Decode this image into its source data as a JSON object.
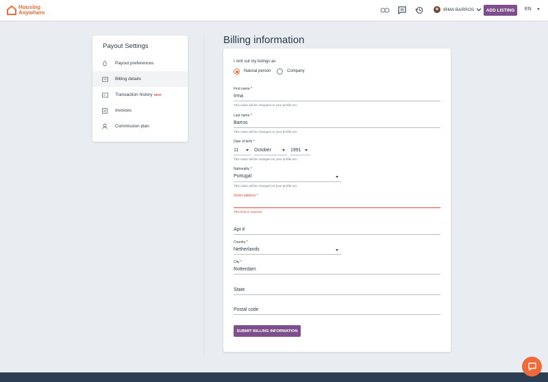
{
  "brand": {
    "line1": "Housing",
    "line2": "Anywhere",
    "color": "#ef6a3a"
  },
  "header": {
    "icons": [
      "favorites-icon",
      "messages-icon",
      "history-icon"
    ],
    "user_name": "IRMA BARROS",
    "add_listing_label": "ADD LISTING",
    "language": "EN"
  },
  "sidebar": {
    "title": "Payout Settings",
    "items": [
      {
        "label": "Payout preferences",
        "icon": "payout-icon",
        "badge": ""
      },
      {
        "label": "Billing details",
        "icon": "billing-icon",
        "badge": "",
        "active": true
      },
      {
        "label": "Transaction history",
        "icon": "transaction-icon",
        "badge": "NEW"
      },
      {
        "label": "Invoices",
        "icon": "invoice-icon",
        "badge": ""
      },
      {
        "label": "Commission plan",
        "icon": "commission-icon",
        "badge": ""
      }
    ]
  },
  "main": {
    "title": "Billing information",
    "rent_label": "I rent out my listings as",
    "rent_options": [
      {
        "label": "Natural person",
        "selected": true
      },
      {
        "label": "Company",
        "selected": false
      }
    ],
    "first_name": {
      "label": "First name *",
      "value": "Irma",
      "hint": "This value will be changed on your profile too."
    },
    "last_name": {
      "label": "Last name *",
      "value": "Barros",
      "hint": "This value will be changed on your profile too."
    },
    "dob": {
      "label": "Date of birth *",
      "day": "11",
      "month": "October",
      "year": "1991",
      "hint": "This value will be changed on your profile too."
    },
    "nationality": {
      "label": "Nationality *",
      "value": "Portugal",
      "hint": "This value will be changed on your profile too."
    },
    "street": {
      "label": "Street address *",
      "value": "",
      "error": "This field is required"
    },
    "apt": {
      "placeholder": "Apt #"
    },
    "country": {
      "label": "Country *",
      "value": "Netherlands"
    },
    "city": {
      "label": "City *",
      "value": "Rotterdam"
    },
    "state": {
      "placeholder": "State"
    },
    "postal": {
      "placeholder": "Postal code"
    },
    "submit_label": "SUBMIT BILLING INFORMATION"
  },
  "colors": {
    "accent": "#7f4f8d",
    "orange": "#ef6a3a",
    "error": "#e0483e",
    "footer": "#2b3e52"
  }
}
